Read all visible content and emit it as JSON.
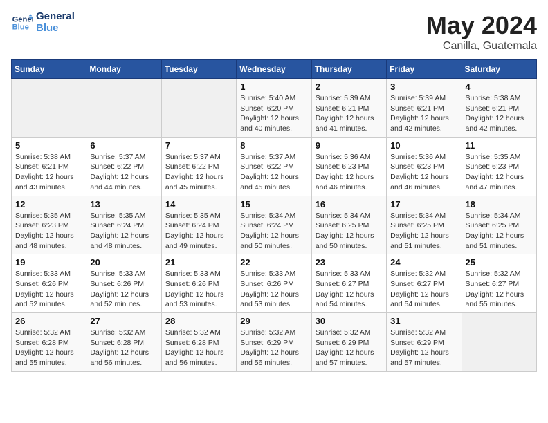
{
  "header": {
    "logo_line1": "General",
    "logo_line2": "Blue",
    "title": "May 2024",
    "subtitle": "Canilla, Guatemala"
  },
  "weekdays": [
    "Sunday",
    "Monday",
    "Tuesday",
    "Wednesday",
    "Thursday",
    "Friday",
    "Saturday"
  ],
  "weeks": [
    [
      {
        "day": "",
        "detail": ""
      },
      {
        "day": "",
        "detail": ""
      },
      {
        "day": "",
        "detail": ""
      },
      {
        "day": "1",
        "detail": "Sunrise: 5:40 AM\nSunset: 6:20 PM\nDaylight: 12 hours\nand 40 minutes."
      },
      {
        "day": "2",
        "detail": "Sunrise: 5:39 AM\nSunset: 6:21 PM\nDaylight: 12 hours\nand 41 minutes."
      },
      {
        "day": "3",
        "detail": "Sunrise: 5:39 AM\nSunset: 6:21 PM\nDaylight: 12 hours\nand 42 minutes."
      },
      {
        "day": "4",
        "detail": "Sunrise: 5:38 AM\nSunset: 6:21 PM\nDaylight: 12 hours\nand 42 minutes."
      }
    ],
    [
      {
        "day": "5",
        "detail": "Sunrise: 5:38 AM\nSunset: 6:21 PM\nDaylight: 12 hours\nand 43 minutes."
      },
      {
        "day": "6",
        "detail": "Sunrise: 5:37 AM\nSunset: 6:22 PM\nDaylight: 12 hours\nand 44 minutes."
      },
      {
        "day": "7",
        "detail": "Sunrise: 5:37 AM\nSunset: 6:22 PM\nDaylight: 12 hours\nand 45 minutes."
      },
      {
        "day": "8",
        "detail": "Sunrise: 5:37 AM\nSunset: 6:22 PM\nDaylight: 12 hours\nand 45 minutes."
      },
      {
        "day": "9",
        "detail": "Sunrise: 5:36 AM\nSunset: 6:23 PM\nDaylight: 12 hours\nand 46 minutes."
      },
      {
        "day": "10",
        "detail": "Sunrise: 5:36 AM\nSunset: 6:23 PM\nDaylight: 12 hours\nand 46 minutes."
      },
      {
        "day": "11",
        "detail": "Sunrise: 5:35 AM\nSunset: 6:23 PM\nDaylight: 12 hours\nand 47 minutes."
      }
    ],
    [
      {
        "day": "12",
        "detail": "Sunrise: 5:35 AM\nSunset: 6:23 PM\nDaylight: 12 hours\nand 48 minutes."
      },
      {
        "day": "13",
        "detail": "Sunrise: 5:35 AM\nSunset: 6:24 PM\nDaylight: 12 hours\nand 48 minutes."
      },
      {
        "day": "14",
        "detail": "Sunrise: 5:35 AM\nSunset: 6:24 PM\nDaylight: 12 hours\nand 49 minutes."
      },
      {
        "day": "15",
        "detail": "Sunrise: 5:34 AM\nSunset: 6:24 PM\nDaylight: 12 hours\nand 50 minutes."
      },
      {
        "day": "16",
        "detail": "Sunrise: 5:34 AM\nSunset: 6:25 PM\nDaylight: 12 hours\nand 50 minutes."
      },
      {
        "day": "17",
        "detail": "Sunrise: 5:34 AM\nSunset: 6:25 PM\nDaylight: 12 hours\nand 51 minutes."
      },
      {
        "day": "18",
        "detail": "Sunrise: 5:34 AM\nSunset: 6:25 PM\nDaylight: 12 hours\nand 51 minutes."
      }
    ],
    [
      {
        "day": "19",
        "detail": "Sunrise: 5:33 AM\nSunset: 6:26 PM\nDaylight: 12 hours\nand 52 minutes."
      },
      {
        "day": "20",
        "detail": "Sunrise: 5:33 AM\nSunset: 6:26 PM\nDaylight: 12 hours\nand 52 minutes."
      },
      {
        "day": "21",
        "detail": "Sunrise: 5:33 AM\nSunset: 6:26 PM\nDaylight: 12 hours\nand 53 minutes."
      },
      {
        "day": "22",
        "detail": "Sunrise: 5:33 AM\nSunset: 6:26 PM\nDaylight: 12 hours\nand 53 minutes."
      },
      {
        "day": "23",
        "detail": "Sunrise: 5:33 AM\nSunset: 6:27 PM\nDaylight: 12 hours\nand 54 minutes."
      },
      {
        "day": "24",
        "detail": "Sunrise: 5:32 AM\nSunset: 6:27 PM\nDaylight: 12 hours\nand 54 minutes."
      },
      {
        "day": "25",
        "detail": "Sunrise: 5:32 AM\nSunset: 6:27 PM\nDaylight: 12 hours\nand 55 minutes."
      }
    ],
    [
      {
        "day": "26",
        "detail": "Sunrise: 5:32 AM\nSunset: 6:28 PM\nDaylight: 12 hours\nand 55 minutes."
      },
      {
        "day": "27",
        "detail": "Sunrise: 5:32 AM\nSunset: 6:28 PM\nDaylight: 12 hours\nand 56 minutes."
      },
      {
        "day": "28",
        "detail": "Sunrise: 5:32 AM\nSunset: 6:28 PM\nDaylight: 12 hours\nand 56 minutes."
      },
      {
        "day": "29",
        "detail": "Sunrise: 5:32 AM\nSunset: 6:29 PM\nDaylight: 12 hours\nand 56 minutes."
      },
      {
        "day": "30",
        "detail": "Sunrise: 5:32 AM\nSunset: 6:29 PM\nDaylight: 12 hours\nand 57 minutes."
      },
      {
        "day": "31",
        "detail": "Sunrise: 5:32 AM\nSunset: 6:29 PM\nDaylight: 12 hours\nand 57 minutes."
      },
      {
        "day": "",
        "detail": ""
      }
    ]
  ]
}
